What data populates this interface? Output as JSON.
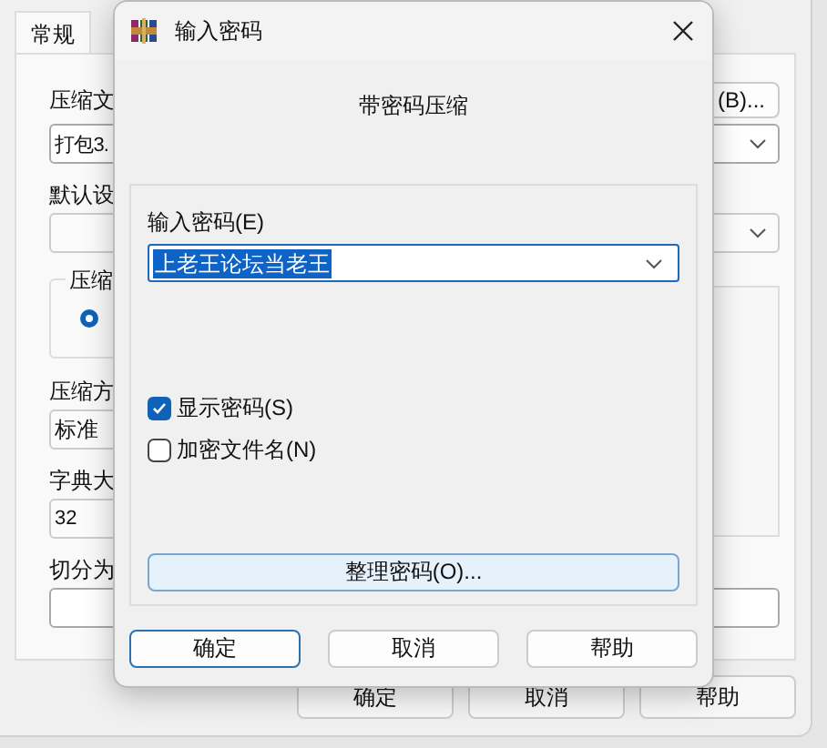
{
  "main_window": {
    "tab": {
      "label": "常规",
      "selected": true
    },
    "archive_name_label": "压缩文",
    "browse_button": "(B)...",
    "archive_name_value": "打包3.",
    "profile_label": "默认设",
    "format_group_label": "压缩",
    "format_radio": {
      "selected": true
    },
    "method_label": "压缩方",
    "method_value": "标准",
    "dictionary_label": "字典大",
    "dictionary_value": "32",
    "split_label": "切分为",
    "buttons": [
      "确定",
      "取消",
      "帮助"
    ]
  },
  "dialog": {
    "title": "输入密码",
    "heading": "带密码压缩",
    "password_label": "输入密码(E)",
    "password_value": "上老王论坛当老王",
    "options": [
      {
        "label": "显示密码(S)",
        "checked": true
      },
      {
        "label": "加密文件名(N)",
        "checked": false
      }
    ],
    "organize_button": "整理密码(O)...",
    "buttons": [
      "确定",
      "取消",
      "帮助"
    ]
  }
}
